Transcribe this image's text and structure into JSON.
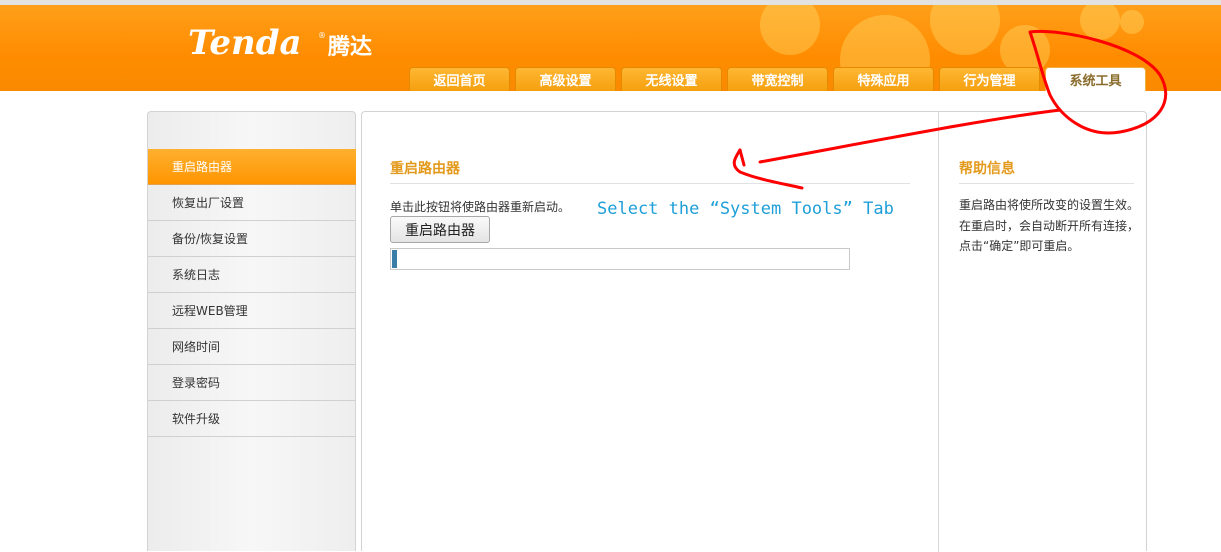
{
  "brand": {
    "logo_text": "Tenda",
    "logo_cn": "腾达",
    "registered_mark": "®"
  },
  "tabs": [
    {
      "label": "返回首页"
    },
    {
      "label": "高级设置"
    },
    {
      "label": "无线设置"
    },
    {
      "label": "带宽控制"
    },
    {
      "label": "特殊应用"
    },
    {
      "label": "行为管理"
    },
    {
      "label": "系统工具",
      "active": true
    }
  ],
  "sidebar": {
    "items": [
      {
        "label": "重启路由器",
        "active": true
      },
      {
        "label": "恢复出厂设置"
      },
      {
        "label": "备份/恢复设置"
      },
      {
        "label": "系统日志"
      },
      {
        "label": "远程WEB管理"
      },
      {
        "label": "网络时间"
      },
      {
        "label": "登录密码"
      },
      {
        "label": "软件升级"
      }
    ]
  },
  "main": {
    "title": "重启路由器",
    "description": "单击此按钮将使路由器重新启动。",
    "reboot_button": "重启路由器",
    "progress": 0.01
  },
  "help": {
    "title": "帮助信息",
    "text": "重启路由将使所改变的设置生效。在重启时，会自动断开所有连接，点击“确定”即可重启。"
  },
  "annotation": {
    "text": "Select the “System Tools” Tab",
    "color": "#1e9fd8"
  },
  "colors": {
    "brand_orange": "#ff8c00",
    "title_orange": "#e39a1c",
    "scribble_red": "#ff0000"
  },
  "icons": {
    "scribble": "red-arrow-annotation"
  }
}
